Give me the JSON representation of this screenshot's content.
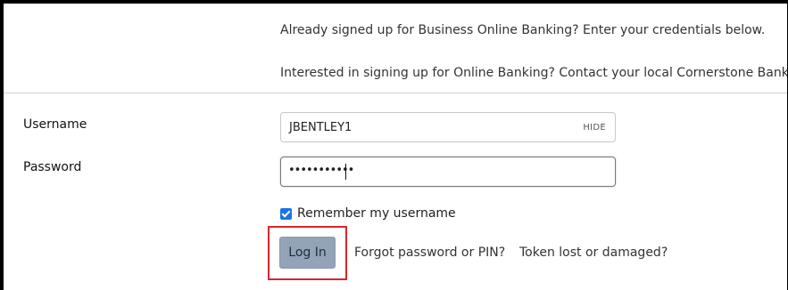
{
  "info": {
    "line1": "Already signed up for Business Online Banking? Enter your credentials below.",
    "line2": "Interested in signing up for Online Banking? Contact your local Cornerstone Bank."
  },
  "form": {
    "username_label": "Username",
    "username_value": "JBENTLEY1",
    "hide_label": "HIDE",
    "password_label": "Password",
    "password_masked": "•••••••••••",
    "remember_label": "Remember my username",
    "remember_checked": true,
    "login_label": "Log In",
    "forgot_link": "Forgot password or PIN?",
    "token_link": "Token lost or damaged?"
  },
  "colors": {
    "highlight_border": "#d9262c",
    "login_button_bg": "#93a3b8",
    "checkbox": "#1a73e8"
  }
}
